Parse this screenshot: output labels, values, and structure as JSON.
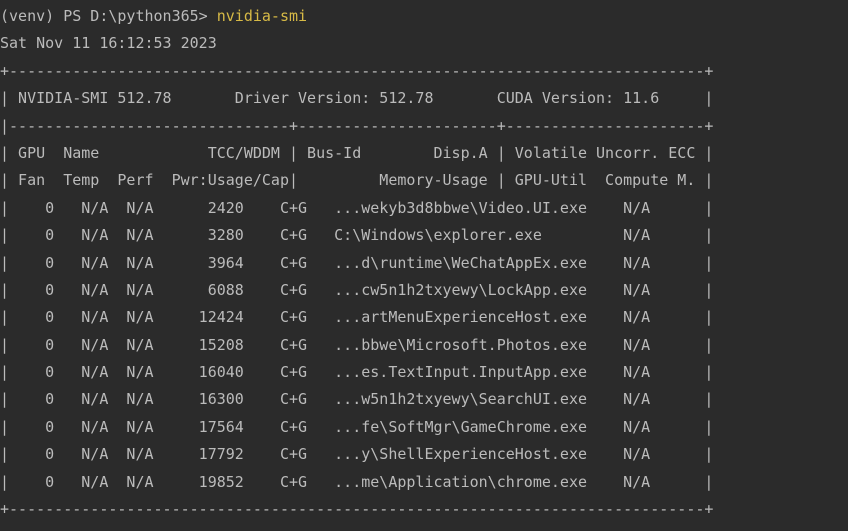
{
  "colors": {
    "background": "#2b2b2b",
    "text": "#bbbbbb",
    "command": "#d7ba46"
  },
  "prompt": {
    "prefix": "(venv) PS D:\\python365> ",
    "command": "nvidia-smi"
  },
  "timestamp": "Sat Nov 11 16:12:53 2023",
  "lines": [
    "+-----------------------------------------------------------------------------+",
    "| NVIDIA-SMI 512.78       Driver Version: 512.78       CUDA Version: 11.6     |",
    "|-------------------------------+----------------------+----------------------+",
    "| GPU  Name            TCC/WDDM | Bus-Id        Disp.A | Volatile Uncorr. ECC |",
    "| Fan  Temp  Perf  Pwr:Usage/Cap|         Memory-Usage | GPU-Util  Compute M. |",
    "|    0   N/A  N/A      2420    C+G   ...wekyb3d8bbwe\\Video.UI.exe    N/A      |",
    "|    0   N/A  N/A      3280    C+G   C:\\Windows\\explorer.exe         N/A      |",
    "|    0   N/A  N/A      3964    C+G   ...d\\runtime\\WeChatAppEx.exe    N/A      |",
    "|    0   N/A  N/A      6088    C+G   ...cw5n1h2txyewy\\LockApp.exe    N/A      |",
    "|    0   N/A  N/A     12424    C+G   ...artMenuExperienceHost.exe    N/A      |",
    "|    0   N/A  N/A     15208    C+G   ...bbwe\\Microsoft.Photos.exe    N/A      |",
    "|    0   N/A  N/A     16040    C+G   ...es.TextInput.InputApp.exe    N/A      |",
    "|    0   N/A  N/A     16300    C+G   ...w5n1h2txyewy\\SearchUI.exe    N/A      |",
    "|    0   N/A  N/A     17564    C+G   ...fe\\SoftMgr\\GameChrome.exe    N/A      |",
    "|    0   N/A  N/A     17792    C+G   ...y\\ShellExperienceHost.exe    N/A      |",
    "|    0   N/A  N/A     19852    C+G   ...me\\Application\\chrome.exe    N/A      |",
    "+-----------------------------------------------------------------------------+"
  ]
}
